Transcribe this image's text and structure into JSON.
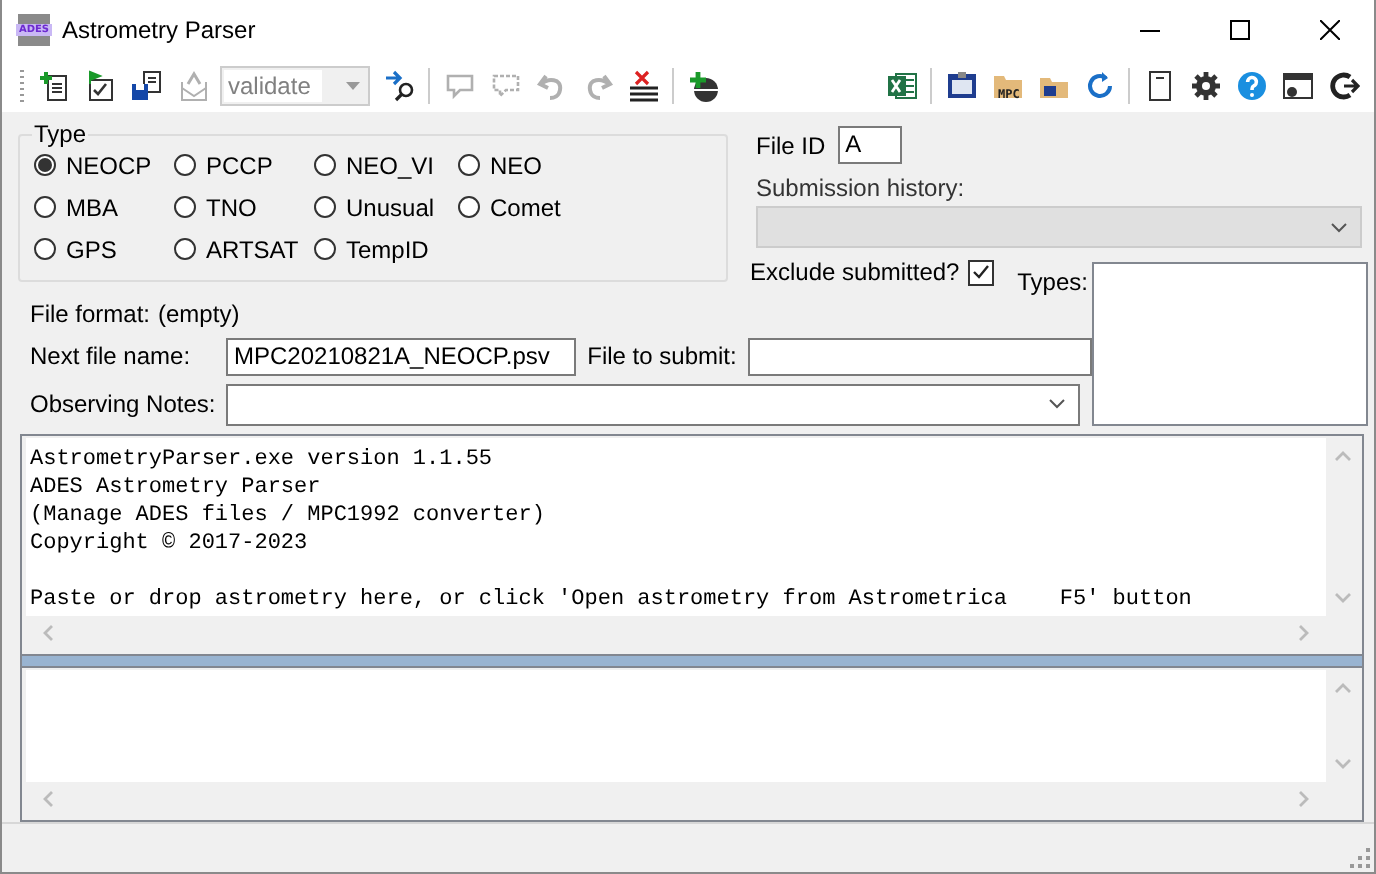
{
  "window": {
    "title": "Astrometry Parser",
    "icon_label": "ADES"
  },
  "toolbar": {
    "left": [
      {
        "disabled": false
      },
      {
        "disabled": false
      },
      {
        "disabled": false
      },
      {
        "disabled": true
      }
    ],
    "mode_combo": {
      "value": "validate",
      "disabled": true
    },
    "middle": [
      {
        "disabled": false
      },
      {
        "disabled": true
      },
      {
        "disabled": true
      },
      {
        "disabled": true
      },
      {
        "disabled": true
      },
      {
        "disabled": false
      },
      {
        "disabled": false
      }
    ],
    "folder_icon_label": "MPC"
  },
  "type_group": {
    "title": "Type",
    "options": [
      {
        "label": "NEOCP",
        "selected": true
      },
      {
        "label": "PCCP",
        "selected": false
      },
      {
        "label": "NEO_VI",
        "selected": false
      },
      {
        "label": "NEO",
        "selected": false
      },
      {
        "label": "MBA",
        "selected": false
      },
      {
        "label": "TNO",
        "selected": false
      },
      {
        "label": "Unusual",
        "selected": false
      },
      {
        "label": "Comet",
        "selected": false
      },
      {
        "label": "GPS",
        "selected": false
      },
      {
        "label": "ARTSAT",
        "selected": false
      },
      {
        "label": "TempID",
        "selected": false
      }
    ]
  },
  "file_id": {
    "label": "File ID",
    "value": "A"
  },
  "submission_history": {
    "label": "Submission history:",
    "disabled": true
  },
  "exclude_submitted": {
    "label": "Exclude submitted?",
    "checked": true
  },
  "types": {
    "label": "Types:"
  },
  "file_format": {
    "label": "File format:",
    "value": "(empty)"
  },
  "next_file_name": {
    "label": "Next file name:",
    "value": "MPC20210821A_NEOCP.psv"
  },
  "file_to_submit": {
    "label": "File to submit:"
  },
  "observing_notes": {
    "label": "Observing Notes:"
  },
  "log": {
    "text": "AstrometryParser.exe version 1.1.55\nADES Astrometry Parser\n(Manage ADES files / MPC1992 converter)\nCopyright © 2017-2023\n\nPaste or drop astrometry here, or click 'Open astrometry from Astrometrica    F5' button"
  }
}
